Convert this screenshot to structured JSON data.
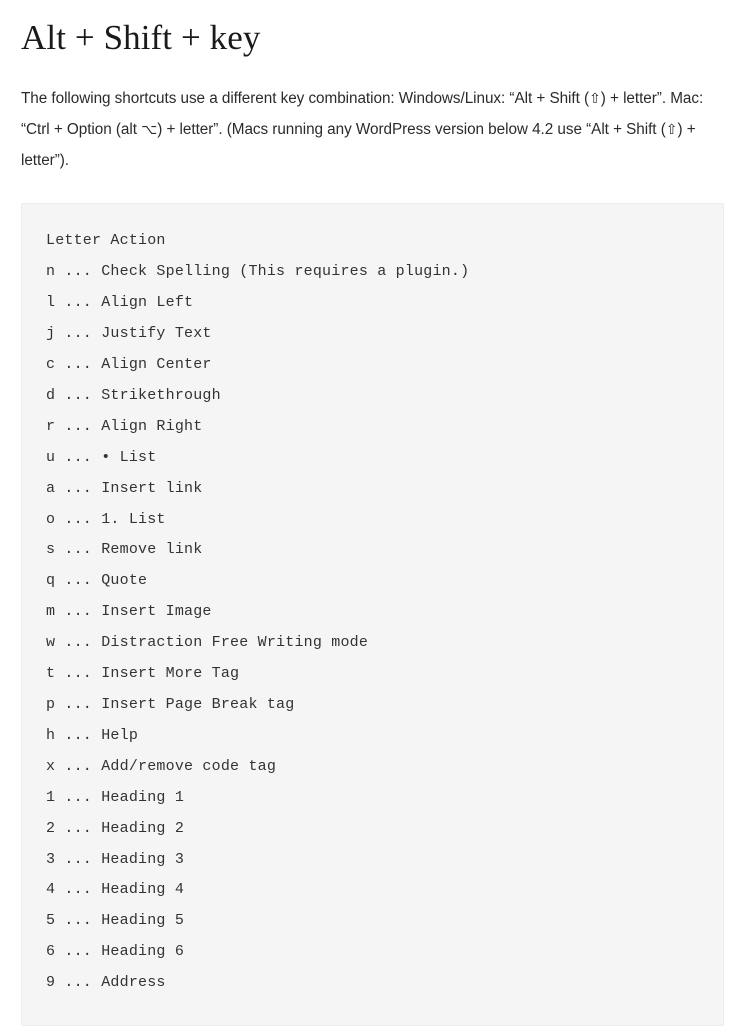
{
  "heading": "Alt + Shift + key",
  "intro": {
    "part1": "The following shortcuts use a different key combination: Windows/Linux: “Alt + Shift (",
    "shift_glyph_1": "⇧",
    "part2": ") + letter”. Mac: “Ctrl + Option (alt ",
    "option_glyph": "⌥",
    "part3": ") + letter”. (Macs running any WordPress version below 4.2 use “Alt + Shift (",
    "shift_glyph_2": "⇧",
    "part4": ") + letter”)."
  },
  "code_block": {
    "header": "Letter Action",
    "separator": " ... ",
    "lines": [
      {
        "letter": "n",
        "action": "Check Spelling (This requires a plugin.)"
      },
      {
        "letter": "l",
        "action": "Align Left"
      },
      {
        "letter": "j",
        "action": "Justify Text"
      },
      {
        "letter": "c",
        "action": "Align Center"
      },
      {
        "letter": "d",
        "action": "Strikethrough"
      },
      {
        "letter": "r",
        "action": "Align Right"
      },
      {
        "letter": "u",
        "action": "• List"
      },
      {
        "letter": "a",
        "action": "Insert link"
      },
      {
        "letter": "o",
        "action": "1. List"
      },
      {
        "letter": "s",
        "action": "Remove link"
      },
      {
        "letter": "q",
        "action": "Quote"
      },
      {
        "letter": "m",
        "action": "Insert Image"
      },
      {
        "letter": "w",
        "action": "Distraction Free Writing mode"
      },
      {
        "letter": "t",
        "action": "Insert More Tag"
      },
      {
        "letter": "p",
        "action": "Insert Page Break tag"
      },
      {
        "letter": "h",
        "action": "Help"
      },
      {
        "letter": "x",
        "action": "Add/remove code tag"
      },
      {
        "letter": "1",
        "action": "Heading 1"
      },
      {
        "letter": "2",
        "action": "Heading 2"
      },
      {
        "letter": "3",
        "action": "Heading 3"
      },
      {
        "letter": "4",
        "action": "Heading 4"
      },
      {
        "letter": "5",
        "action": "Heading 5"
      },
      {
        "letter": "6",
        "action": "Heading 6"
      },
      {
        "letter": "9",
        "action": "Address"
      }
    ]
  },
  "colors": {
    "page_background": "#ffffff",
    "heading_text": "#1a1a1a",
    "body_text": "#2b2b2b",
    "code_text": "#333333",
    "code_background": "#f5f5f5",
    "code_border": "#ededed"
  }
}
